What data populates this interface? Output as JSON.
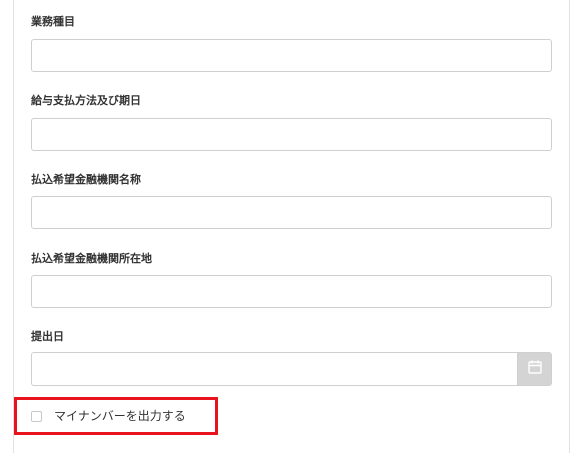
{
  "form": {
    "fields": [
      {
        "label": "業務種目",
        "value": ""
      },
      {
        "label": "給与支払方法及び期日",
        "value": ""
      },
      {
        "label": "払込希望金融機関名称",
        "value": ""
      },
      {
        "label": "払込希望金融機関所在地",
        "value": ""
      }
    ],
    "submit_date": {
      "label": "提出日",
      "value": "",
      "icon": "calendar-icon"
    },
    "my_number_checkbox": {
      "label": "マイナンバーを出力する",
      "checked": false
    }
  },
  "colors": {
    "highlight": "#e8131c",
    "input_border": "#cfcfcf",
    "date_button_bg": "#d4d4d4",
    "label_text": "#333333"
  }
}
